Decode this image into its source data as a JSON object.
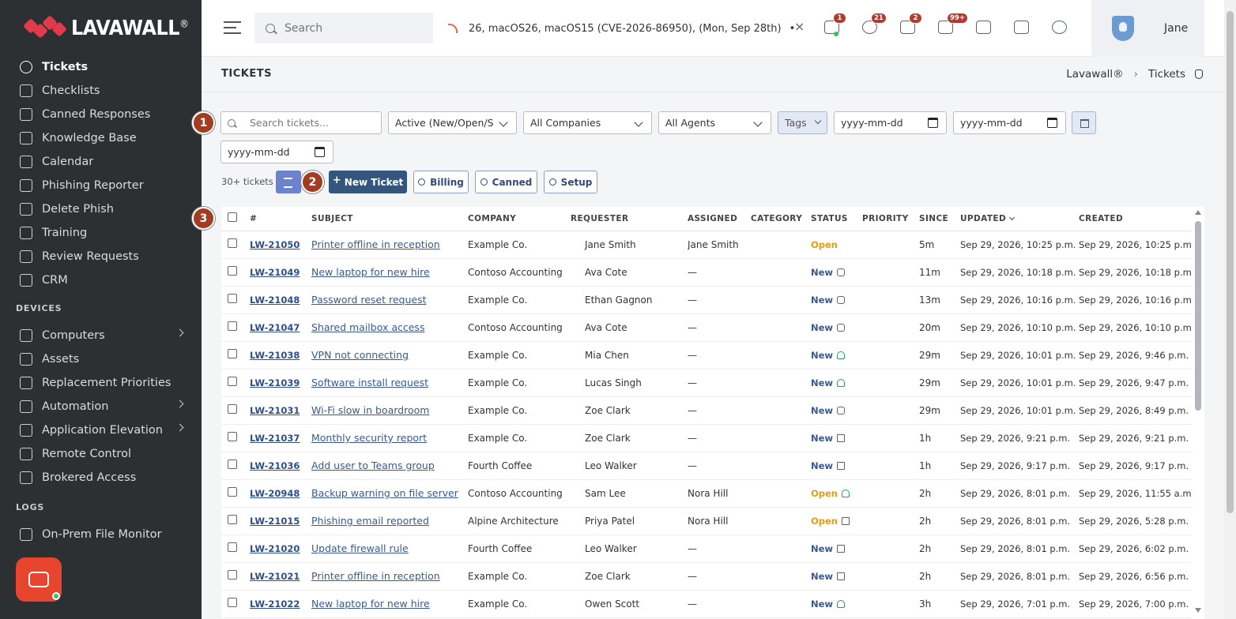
{
  "brand": {
    "name": "LAVAWALL",
    "reg": "®"
  },
  "sidebar": {
    "items": [
      {
        "label": "Tickets",
        "icon": "ticket-icon",
        "active": true
      },
      {
        "label": "Checklists",
        "icon": "checklist-icon"
      },
      {
        "label": "Canned Responses",
        "icon": "canned-responses-icon"
      },
      {
        "label": "Knowledge Base",
        "icon": "book-icon"
      },
      {
        "label": "Calendar",
        "icon": "calendar-icon"
      },
      {
        "label": "Phishing Reporter",
        "icon": "hook-icon"
      },
      {
        "label": "Delete Phish",
        "icon": "mail-delete-icon"
      },
      {
        "label": "Training",
        "icon": "graduation-cap-icon"
      },
      {
        "label": "Review Requests",
        "icon": "shield-check-icon"
      },
      {
        "label": "CRM",
        "icon": "phone-book-icon"
      }
    ],
    "devices_heading": "DEVICES",
    "devices": [
      {
        "label": "Computers",
        "icon": "monitor-icon",
        "chevron": true
      },
      {
        "label": "Assets",
        "icon": "tag-icon"
      },
      {
        "label": "Replacement Priorities",
        "icon": "priority-icon"
      },
      {
        "label": "Automation",
        "icon": "automation-icon",
        "chevron": true
      },
      {
        "label": "Application Elevation",
        "icon": "shield-elevation-icon",
        "chevron": true
      },
      {
        "label": "Remote Control",
        "icon": "remote-monitor-icon"
      },
      {
        "label": "Brokered Access",
        "icon": "network-icon"
      }
    ],
    "logs_heading": "LOGS",
    "logs": [
      {
        "label": "On-Prem File Monitor",
        "icon": "file-monitor-icon"
      }
    ]
  },
  "topbar": {
    "search_placeholder": "Search",
    "ticker_text": "26, macOS26, macOS15 (CVE-2026-86950), (Mon, Sep 28th)",
    "ticker_bullet": "•",
    "ticker_tag": "CR",
    "ticker_close": "×",
    "icons": [
      {
        "name": "messages-icon",
        "badge": "1",
        "online": true
      },
      {
        "name": "timer-icon",
        "badge": "21"
      },
      {
        "name": "qr-code-icon",
        "badge": "2"
      },
      {
        "name": "feed-icon",
        "badge": "99+"
      },
      {
        "name": "text-size-icon"
      },
      {
        "name": "fullscreen-icon"
      },
      {
        "name": "dark-mode-icon"
      }
    ],
    "user_name": "Jane"
  },
  "page": {
    "title": "TICKETS",
    "breadcrumb": [
      "Lavawall®",
      "Tickets"
    ],
    "breadcrumb_sep": "›"
  },
  "filters": {
    "search_placeholder": "Search tickets...",
    "status": "Active (New/Open/S",
    "company": "All Companies",
    "agent": "All Agents",
    "tags": "Tags",
    "date_placeholder": "yyyy-mm-dd"
  },
  "markers": [
    "1",
    "2",
    "3"
  ],
  "toolbar": {
    "count": "30+ tickets",
    "new_ticket": "New Ticket",
    "billing": "Billing",
    "canned": "Canned",
    "setup": "Setup"
  },
  "table": {
    "columns": [
      "#",
      "SUBJECT",
      "COMPANY",
      "REQUESTER",
      "ASSIGNED",
      "CATEGORY",
      "STATUS",
      "PRIORITY",
      "SINCE",
      "UPDATED",
      "CREATED"
    ],
    "rows": [
      {
        "id": "LW-21050",
        "subject": "Printer offline in reception",
        "company": "Example Co.",
        "requester": "Jane Smith",
        "assigned": "Jane Smith",
        "status": "Open",
        "status_icon": "",
        "since": "5m",
        "updated": "Sep 29, 2026, 10:25 p.m.",
        "created": "Sep 29, 2026, 10:25 p.m."
      },
      {
        "id": "LW-21049",
        "subject": "New laptop for new hire",
        "company": "Contoso Accounting",
        "requester": "Ava Cote",
        "assigned": "—",
        "status": "New",
        "status_icon": "team",
        "since": "11m",
        "updated": "Sep 29, 2026, 10:18 p.m.",
        "created": "Sep 29, 2026, 10:18 p.m."
      },
      {
        "id": "LW-21048",
        "subject": "Password reset request",
        "company": "Example Co.",
        "requester": "Ethan Gagnon",
        "assigned": "—",
        "status": "New",
        "status_icon": "team",
        "since": "13m",
        "updated": "Sep 29, 2026, 10:16 p.m.",
        "created": "Sep 29, 2026, 10:16 p.m."
      },
      {
        "id": "LW-21047",
        "subject": "Shared mailbox access",
        "company": "Contoso Accounting",
        "requester": "Ava Cote",
        "assigned": "—",
        "status": "New",
        "status_icon": "team",
        "since": "20m",
        "updated": "Sep 29, 2026, 10:10 p.m.",
        "created": "Sep 29, 2026, 10:10 p.m."
      },
      {
        "id": "LW-21038",
        "subject": "VPN not connecting",
        "company": "Example Co.",
        "requester": "Mia Chen",
        "assigned": "—",
        "status": "New",
        "status_icon": "person",
        "since": "29m",
        "updated": "Sep 29, 2026, 10:01 p.m.",
        "created": "Sep 29, 2026, 9:46 p.m."
      },
      {
        "id": "LW-21039",
        "subject": "Software install request",
        "company": "Example Co.",
        "requester": "Lucas Singh",
        "assigned": "—",
        "status": "New",
        "status_icon": "person",
        "since": "29m",
        "updated": "Sep 29, 2026, 10:01 p.m.",
        "created": "Sep 29, 2026, 9:47 p.m."
      },
      {
        "id": "LW-21031",
        "subject": "Wi-Fi slow in boardroom",
        "company": "Example Co.",
        "requester": "Zoe Clark",
        "assigned": "—",
        "status": "New",
        "status_icon": "team",
        "since": "29m",
        "updated": "Sep 29, 2026, 10:01 p.m.",
        "created": "Sep 29, 2026, 8:49 p.m."
      },
      {
        "id": "LW-21037",
        "subject": "Monthly security report",
        "company": "Example Co.",
        "requester": "Zoe Clark",
        "assigned": "—",
        "status": "New",
        "status_icon": "doc",
        "since": "1h",
        "updated": "Sep 29, 2026, 9:21 p.m.",
        "created": "Sep 29, 2026, 9:21 p.m."
      },
      {
        "id": "LW-21036",
        "subject": "Add user to Teams group",
        "company": "Fourth Coffee",
        "requester": "Leo Walker",
        "assigned": "—",
        "status": "New",
        "status_icon": "doc",
        "since": "1h",
        "updated": "Sep 29, 2026, 9:17 p.m.",
        "created": "Sep 29, 2026, 9:17 p.m."
      },
      {
        "id": "LW-20948",
        "subject": "Backup warning on file server",
        "company": "Contoso Accounting",
        "requester": "Sam Lee",
        "assigned": "Nora Hill",
        "status": "Open",
        "status_icon": "person",
        "since": "2h",
        "updated": "Sep 29, 2026, 8:01 p.m.",
        "created": "Sep 29, 2026, 11:55 a.m."
      },
      {
        "id": "LW-21015",
        "subject": "Phishing email reported",
        "company": "Alpine Architecture",
        "requester": "Priya Patel",
        "assigned": "Nora Hill",
        "status": "Open",
        "status_icon": "doc",
        "since": "2h",
        "updated": "Sep 29, 2026, 8:01 p.m.",
        "created": "Sep 29, 2026, 5:28 p.m."
      },
      {
        "id": "LW-21020",
        "subject": "Update firewall rule",
        "company": "Fourth Coffee",
        "requester": "Leo Walker",
        "assigned": "—",
        "status": "New",
        "status_icon": "doc",
        "since": "2h",
        "updated": "Sep 29, 2026, 8:01 p.m.",
        "created": "Sep 29, 2026, 6:02 p.m."
      },
      {
        "id": "LW-21021",
        "subject": "Printer offline in reception",
        "company": "Example Co.",
        "requester": "Zoe Clark",
        "assigned": "—",
        "status": "New",
        "status_icon": "doc",
        "since": "2h",
        "updated": "Sep 29, 2026, 8:01 p.m.",
        "created": "Sep 29, 2026, 6:56 p.m."
      },
      {
        "id": "LW-21022",
        "subject": "New laptop for new hire",
        "company": "Example Co.",
        "requester": "Owen Scott",
        "assigned": "—",
        "status": "New",
        "status_icon": "person",
        "since": "3h",
        "updated": "Sep 29, 2026, 7:01 p.m.",
        "created": "Sep 29, 2026, 7:00 p.m."
      }
    ]
  },
  "colors": {
    "accent": "#34567d",
    "marker": "#a23d23",
    "open": "#e69b1e",
    "new": "#3a5a8f",
    "sidebar": "#2c3032"
  }
}
